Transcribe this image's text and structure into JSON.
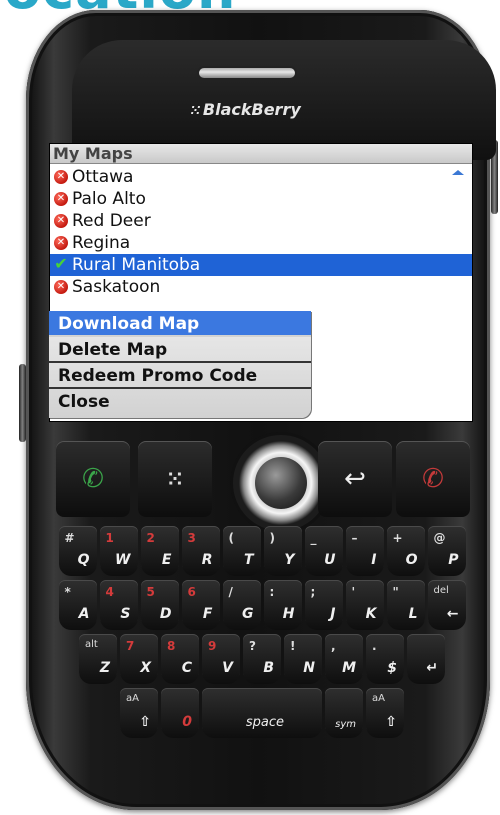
{
  "banner": {
    "text": "ocation"
  },
  "device": {
    "brand": "BlackBerry",
    "brand_dots": "⁙"
  },
  "screen": {
    "title": "My Maps",
    "list": [
      {
        "label": "Ottawa",
        "status": "not-downloaded",
        "icon": "error-icon"
      },
      {
        "label": "Palo Alto",
        "status": "not-downloaded",
        "icon": "error-icon"
      },
      {
        "label": "Red Deer",
        "status": "not-downloaded",
        "icon": "error-icon"
      },
      {
        "label": "Regina",
        "status": "not-downloaded",
        "icon": "error-icon"
      },
      {
        "label": "Rural Manitoba",
        "status": "downloaded",
        "icon": "check-icon"
      },
      {
        "label": "Saskatoon",
        "status": "not-downloaded",
        "icon": "error-icon"
      }
    ],
    "selected_index": 4,
    "menu": {
      "items": [
        "Download Map",
        "Delete Map",
        "Redeem Promo Code",
        "Close"
      ],
      "highlighted_index": 0
    }
  },
  "keyboard": {
    "row1": [
      {
        "main": "Q",
        "alt": "#",
        "alt_red": false
      },
      {
        "main": "W",
        "alt": "1",
        "alt_red": true
      },
      {
        "main": "E",
        "alt": "2",
        "alt_red": true
      },
      {
        "main": "R",
        "alt": "3",
        "alt_red": true
      },
      {
        "main": "T",
        "alt": "(",
        "alt_red": false
      },
      {
        "main": "Y",
        "alt": ")",
        "alt_red": false
      },
      {
        "main": "U",
        "alt": "_",
        "alt_red": false
      },
      {
        "main": "I",
        "alt": "–",
        "alt_red": false
      },
      {
        "main": "O",
        "alt": "+",
        "alt_red": false
      },
      {
        "main": "P",
        "alt": "@",
        "alt_red": false
      }
    ],
    "row2": [
      {
        "main": "A",
        "alt": "*",
        "alt_red": false
      },
      {
        "main": "S",
        "alt": "4",
        "alt_red": true
      },
      {
        "main": "D",
        "alt": "5",
        "alt_red": true
      },
      {
        "main": "F",
        "alt": "6",
        "alt_red": true
      },
      {
        "main": "G",
        "alt": "/",
        "alt_red": false
      },
      {
        "main": "H",
        "alt": ":",
        "alt_red": false
      },
      {
        "main": "J",
        "alt": ";",
        "alt_red": false
      },
      {
        "main": "K",
        "alt": "'",
        "alt_red": false
      },
      {
        "main": "L",
        "alt": "\"",
        "alt_red": false
      },
      {
        "main": "←",
        "alt": "del",
        "alt_red": false
      }
    ],
    "row3": [
      {
        "main": "Z",
        "alt": "alt",
        "alt_red": false
      },
      {
        "main": "X",
        "alt": "7",
        "alt_red": true
      },
      {
        "main": "C",
        "alt": "8",
        "alt_red": true
      },
      {
        "main": "V",
        "alt": "9",
        "alt_red": true
      },
      {
        "main": "B",
        "alt": "?",
        "alt_red": false
      },
      {
        "main": "N",
        "alt": "!",
        "alt_red": false
      },
      {
        "main": "M",
        "alt": ",",
        "alt_red": false
      },
      {
        "main": "$",
        "alt": ".",
        "alt_red": false
      },
      {
        "main": "↵",
        "alt": "",
        "alt_red": false
      }
    ],
    "row4": [
      {
        "main": "⇧",
        "alt": "aA",
        "alt_red": false
      },
      {
        "main": "0",
        "alt": "",
        "alt_red": true
      },
      {
        "main": "space",
        "alt": "",
        "alt_red": false
      },
      {
        "main": "sym",
        "alt": "",
        "alt_red": false
      },
      {
        "main": "⇧",
        "alt": "aA",
        "alt_red": false
      }
    ]
  },
  "nav_keys": {
    "call": "✆",
    "menu": "⁙",
    "back": "↩",
    "end": "✆"
  }
}
